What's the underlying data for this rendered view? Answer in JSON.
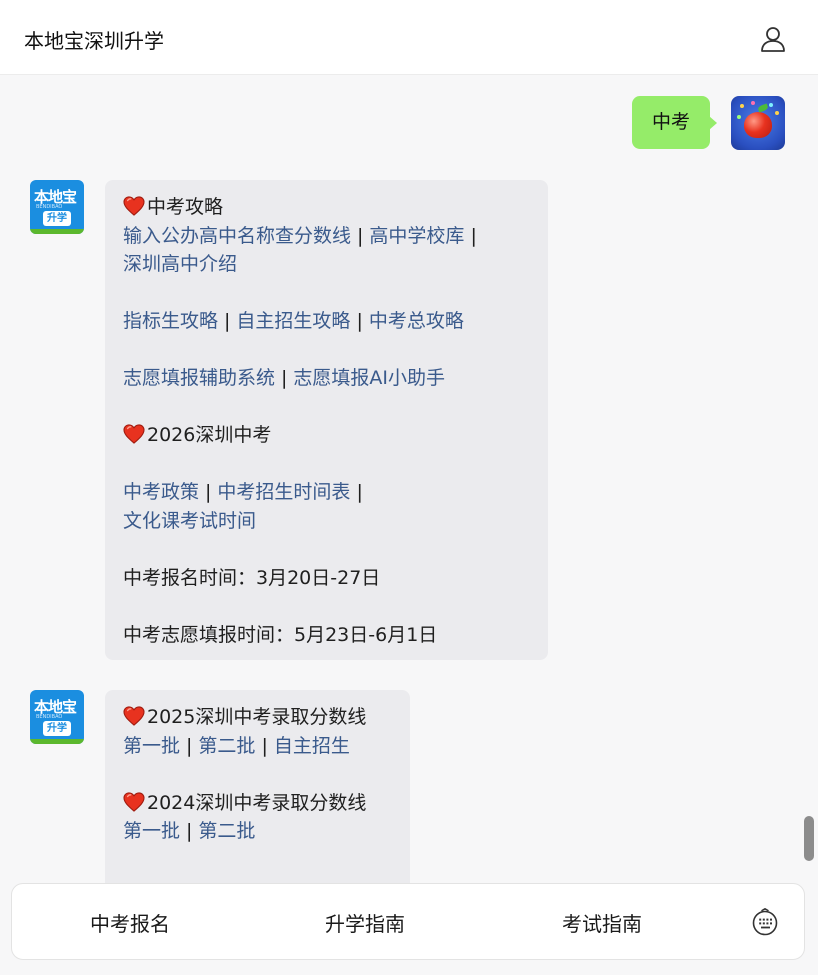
{
  "header": {
    "title": "本地宝深圳升学",
    "user_icon": "user-icon"
  },
  "messages": {
    "user_message": {
      "text": "中考"
    },
    "bot1": {
      "section1_title": "中考攻略",
      "links_row1": [
        "输入公办高中名称查分数线",
        "高中学校库"
      ],
      "links_row2": [
        "深圳高中介绍"
      ],
      "links_row3": [
        "指标生攻略",
        "自主招生攻略",
        "中考总攻略"
      ],
      "links_row4": [
        "志愿填报辅助系统",
        "志愿填报AI小助手"
      ],
      "section2_title": "2026深圳中考",
      "links_row5": [
        "中考政策",
        "中考招生时间表"
      ],
      "links_row6": [
        "文化课考试时间"
      ],
      "info1": "中考报名时间：3月20日-27日",
      "info2": "中考志愿填报时间：5月23日-6月1日"
    },
    "bot2": {
      "section1_title": "2025深圳中考录取分数线",
      "links_row1": [
        "第一批",
        "第二批",
        "自主招生"
      ],
      "section2_title": "2024深圳中考录取分数线",
      "links_row2": [
        "第一批",
        "第二批"
      ]
    }
  },
  "bottom_menu": {
    "items": [
      "中考报名",
      "升学指南",
      "考试指南"
    ],
    "keyboard_icon": "keyboard-icon"
  },
  "colors": {
    "user_bubble": "#95ec69",
    "bot_bubble": "#ebebee",
    "link": "#3a5a8c",
    "heart": "#e8321f"
  }
}
